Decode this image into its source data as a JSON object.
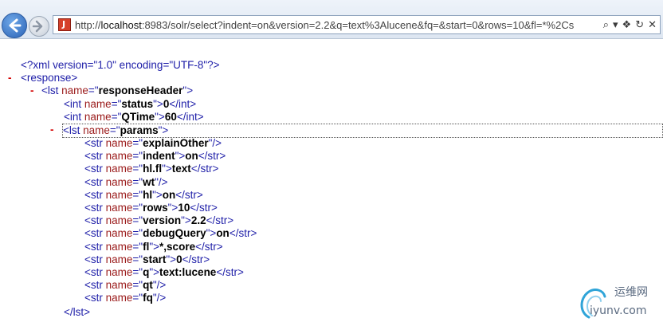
{
  "browser": {
    "url_prefix": "http://",
    "url_host": "localhost",
    "url_rest": ":8983/solr/select?indent=on&version=2.2&q=text%3Alucene&fq=&start=0&rows=10&fl=*%2Cs",
    "favicon_letter": "J"
  },
  "xml": {
    "declaration": "<?xml version=\"1.0\" encoding=\"UTF-8\"?>",
    "response_open": "<response>",
    "header_open_pre": "<lst name=\"",
    "header_name": "responseHeader",
    "status_name": "status",
    "status_value": "0",
    "qtime_name": "QTime",
    "qtime_value": "60",
    "params_name": "params",
    "params": [
      {
        "name": "explainOther",
        "value": null
      },
      {
        "name": "indent",
        "value": "on"
      },
      {
        "name": "hl.fl",
        "value": "text"
      },
      {
        "name": "wt",
        "value": null
      },
      {
        "name": "hl",
        "value": "on"
      },
      {
        "name": "rows",
        "value": "10"
      },
      {
        "name": "version",
        "value": "2.2"
      },
      {
        "name": "debugQuery",
        "value": "on"
      },
      {
        "name": "fl",
        "value": "*,score"
      },
      {
        "name": "start",
        "value": "0"
      },
      {
        "name": "q",
        "value": "text:lucene"
      },
      {
        "name": "qt",
        "value": null
      },
      {
        "name": "fq",
        "value": null
      }
    ],
    "close_lst": "</lst>"
  },
  "watermark": {
    "cn_text": "运维网",
    "domain": "iyunv.com"
  }
}
